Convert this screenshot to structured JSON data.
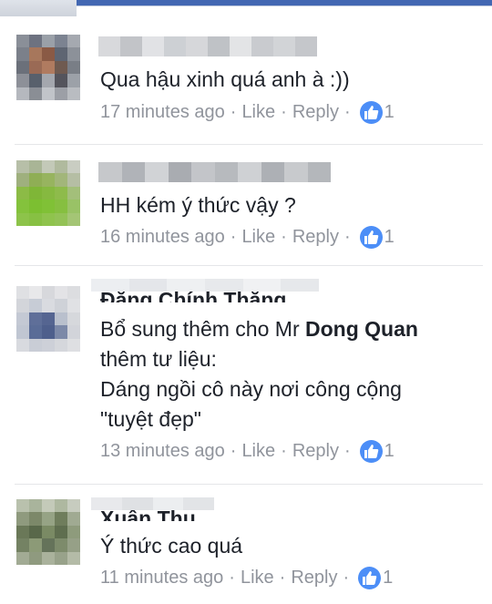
{
  "comments": [
    {
      "text_lines": [
        "Qua hậu xinh quá anh à :))"
      ],
      "time": "17 minutes ago",
      "like_label": "Like",
      "reply_label": "Reply",
      "separator": "·",
      "like_count": "1"
    },
    {
      "text_lines": [
        "HH kém ý thức vậy ?"
      ],
      "time": "16 minutes ago",
      "like_label": "Like",
      "reply_label": "Reply",
      "separator": "·",
      "like_count": "1"
    },
    {
      "name": "Đặng Chính Thắng",
      "text_line1_prefix": "Bổ sung thêm cho Mr ",
      "text_line1_bold": "Dong Quan",
      "text_lines": [
        "thêm tư liệu:",
        "Dáng ngồi cô này nơi công cộng",
        "\"tuyệt đẹp\""
      ],
      "time": "13 minutes ago",
      "like_label": "Like",
      "reply_label": "Reply",
      "separator": "·",
      "like_count": "1"
    },
    {
      "name": "Xuân Thu",
      "text_lines": [
        "Ý thức cao quá"
      ],
      "time": "11 minutes ago",
      "like_label": "Like",
      "reply_label": "Reply",
      "separator": "·",
      "like_count": "1"
    }
  ],
  "icons": {
    "like_badge": "thumbs-up-icon"
  },
  "colors": {
    "like_badge": "#4c8ef7",
    "meta_text": "#90949c",
    "top_bar": "#4267b2"
  }
}
